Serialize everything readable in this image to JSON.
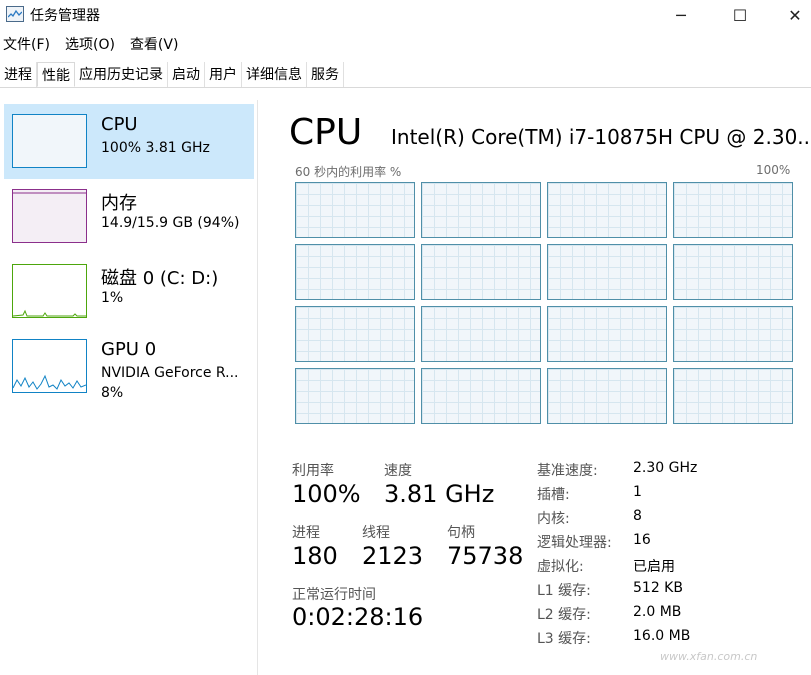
{
  "window": {
    "title": "任务管理器",
    "min": "─",
    "max": "☐",
    "close": "✕"
  },
  "menu": [
    "文件(F)",
    "选项(O)",
    "查看(V)"
  ],
  "tabs": [
    "进程",
    "性能",
    "应用历史记录",
    "启动",
    "用户",
    "详细信息",
    "服务"
  ],
  "active_tab": "性能",
  "sidebar": {
    "items": [
      {
        "title": "CPU",
        "sub": "100% 3.81 GHz",
        "sub2": "",
        "color": "#1183c5"
      },
      {
        "title": "内存",
        "sub": "14.9/15.9 GB (94%)",
        "sub2": "",
        "color": "#8b2f8b"
      },
      {
        "title": "磁盘 0 (C: D:)",
        "sub": "1%",
        "sub2": "",
        "color": "#4da60c"
      },
      {
        "title": "GPU 0",
        "sub": "NVIDIA GeForce R...",
        "sub2": "8%",
        "color": "#1183c5"
      }
    ]
  },
  "main": {
    "title": "CPU",
    "subtitle": "Intel(R) Core(TM) i7-10875H CPU @ 2.30...",
    "graph_caption": "60 秒内的利用率 %",
    "graph_max": "100%",
    "core_count": 16,
    "stats": {
      "util_label": "利用率",
      "util_value": "100%",
      "speed_label": "速度",
      "speed_value": "3.81 GHz",
      "proc_label": "进程",
      "proc_value": "180",
      "thread_label": "线程",
      "thread_value": "2123",
      "handle_label": "句柄",
      "handle_value": "75738",
      "uptime_label": "正常运行时间",
      "uptime_value": "0:02:28:16"
    },
    "details": [
      {
        "label": "基准速度:",
        "value": "2.30 GHz"
      },
      {
        "label": "插槽:",
        "value": "1"
      },
      {
        "label": "内核:",
        "value": "8"
      },
      {
        "label": "逻辑处理器:",
        "value": "16"
      },
      {
        "label": "虚拟化:",
        "value": "已启用"
      },
      {
        "label": "L1 缓存:",
        "value": "512 KB"
      },
      {
        "label": "L2 缓存:",
        "value": "2.0 MB"
      },
      {
        "label": "L3 缓存:",
        "value": "16.0 MB"
      }
    ]
  },
  "watermark": "www.xfan.com.cn"
}
